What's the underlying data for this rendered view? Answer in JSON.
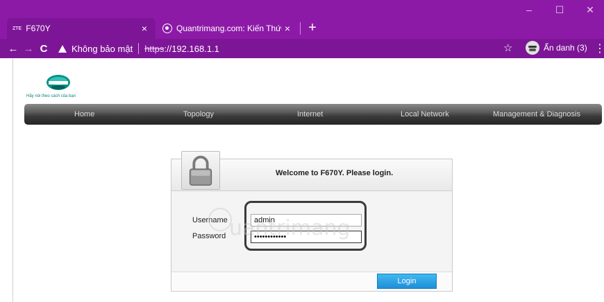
{
  "browser": {
    "tabs": [
      {
        "favicon_text": "ZTE",
        "title": "F670Y",
        "close": "×",
        "active": true
      },
      {
        "title": "Quantrimang.com: Kiến Thức Cô",
        "close": "×",
        "active": false
      }
    ],
    "new_tab": "+",
    "window_controls": {
      "minimize": "–",
      "maximize": "☐",
      "close": "✕"
    },
    "nav": {
      "back": "←",
      "forward": "→",
      "reload": "C"
    },
    "security_text": "Không bảo mật",
    "url_scheme": "https",
    "url_rest": "://192.168.1.1",
    "bookmark_star": "☆",
    "incognito_label": "Ẩn danh (3)",
    "menu": "⋮"
  },
  "router": {
    "slogan": "Hãy nói theo cách của bạn",
    "logo_text": "VIETTEL",
    "nav_items": [
      "Home",
      "Topology",
      "Internet",
      "Local Network",
      "Management & Diagnosis"
    ],
    "login": {
      "welcome": "Welcome to F670Y. Please login.",
      "username_label": "Username",
      "username_value": "admin",
      "password_label": "Password",
      "password_value": "••••••••••••",
      "button_label": "Login"
    },
    "watermark": "uantrimang"
  },
  "colors": {
    "chrome": "#8d1aa7",
    "toolbar": "#7d1696",
    "button": "#1f8fd8",
    "brand": "#0a7f7a"
  }
}
